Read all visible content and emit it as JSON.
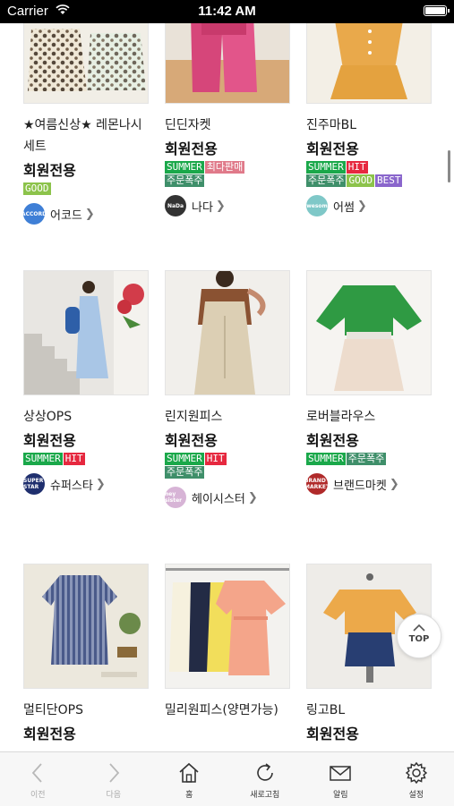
{
  "status_bar": {
    "carrier": "Carrier",
    "time": "11:42 AM"
  },
  "products": [
    {
      "title": "★여름신상★ 레몬나시 세트",
      "price": "회원전용",
      "tags": [
        {
          "text": "GOOD",
          "color": "#8cc34b"
        }
      ],
      "shop": {
        "name": "어코드",
        "logo_text": "ACCORD",
        "logo_color": "#3f7fd6"
      }
    },
    {
      "title": "딘딘자켓",
      "price": "회원전용",
      "tags": [
        {
          "text": "SUMMER",
          "color": "#1aa84a"
        },
        {
          "text": "최다판매",
          "color": "#e07a8a"
        },
        {
          "text": "주문폭주",
          "color": "#3f8f6a"
        }
      ],
      "shop": {
        "name": "나다",
        "logo_text": "NaDa",
        "logo_color": "#333333"
      }
    },
    {
      "title": "진주마BL",
      "price": "회원전용",
      "tags": [
        {
          "text": "SUMMER",
          "color": "#1aa84a"
        },
        {
          "text": "HIT",
          "color": "#e6283f"
        },
        {
          "text": "주문폭주",
          "color": "#3f8f6a"
        },
        {
          "text": "GOOD",
          "color": "#8cc34b"
        },
        {
          "text": "BEST",
          "color": "#8a66cc"
        }
      ],
      "shop": {
        "name": "어썸",
        "logo_text": "awesome",
        "logo_color": "#7fc8c8"
      }
    },
    {
      "title": "상상OPS",
      "price": "회원전용",
      "tags": [
        {
          "text": "SUMMER",
          "color": "#1aa84a"
        },
        {
          "text": "HIT",
          "color": "#e6283f"
        }
      ],
      "shop": {
        "name": "슈퍼스타",
        "logo_text": "SUPER STAR",
        "logo_color": "#1f2f6e"
      }
    },
    {
      "title": "린지원피스",
      "price": "회원전용",
      "tags": [
        {
          "text": "SUMMER",
          "color": "#1aa84a"
        },
        {
          "text": "HIT",
          "color": "#e6283f"
        },
        {
          "text": "주문폭주",
          "color": "#3f8f6a"
        }
      ],
      "shop": {
        "name": "헤이시스터",
        "logo_text": "hey sister",
        "logo_color": "#d7b4d6"
      }
    },
    {
      "title": "로버블라우스",
      "price": "회원전용",
      "tags": [
        {
          "text": "SUMMER",
          "color": "#1aa84a"
        },
        {
          "text": "주문폭주",
          "color": "#3f8f6a"
        }
      ],
      "shop": {
        "name": "브랜드마켓",
        "logo_text": "BRAND MARKET",
        "logo_color": "#b02a2a"
      }
    },
    {
      "title": "멀티단OPS",
      "price": "회원전용",
      "tags": [],
      "shop": null
    },
    {
      "title": "밀리원피스(양면가능)",
      "price": "",
      "tags": [],
      "shop": null
    },
    {
      "title": "링고BL",
      "price": "회원전용",
      "tags": [],
      "shop": null
    }
  ],
  "top_button": {
    "label": "TOP"
  },
  "bottom_nav": [
    {
      "label": "이전",
      "icon": "chevron-left-icon"
    },
    {
      "label": "다음",
      "icon": "chevron-right-icon"
    },
    {
      "label": "홈",
      "icon": "home-icon"
    },
    {
      "label": "새로고침",
      "icon": "refresh-icon"
    },
    {
      "label": "알림",
      "icon": "envelope-icon"
    },
    {
      "label": "설정",
      "icon": "gear-icon"
    }
  ]
}
